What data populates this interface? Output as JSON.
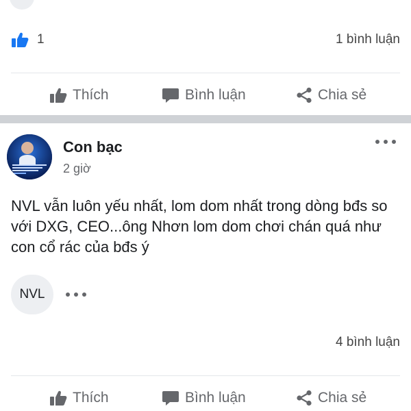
{
  "previous_post": {
    "like_count": "1",
    "comment_count": "1 bình luận",
    "actions": {
      "like": "Thích",
      "comment": "Bình luận",
      "share": "Chia sẻ"
    }
  },
  "post": {
    "author": "Con bạc",
    "time": "2 giờ",
    "text": "NVL vẫn luôn yếu nhất, lom dom nhất trong dòng bđs so với DXG, CEO...ông Nhơn lom dom chơi chán quá như con cổ rác của bđs ý",
    "tag": "NVL",
    "comment_count": "4 bình luận",
    "actions": {
      "like": "Thích",
      "comment": "Bình luận",
      "share": "Chia sẻ"
    }
  },
  "colors": {
    "like_blue": "#1877f2",
    "action_gray": "#65676b",
    "separator": "#cfd2d6"
  },
  "icons": [
    "thumbs-up-icon",
    "comment-bubble-icon",
    "share-icon",
    "more-dots-icon"
  ]
}
